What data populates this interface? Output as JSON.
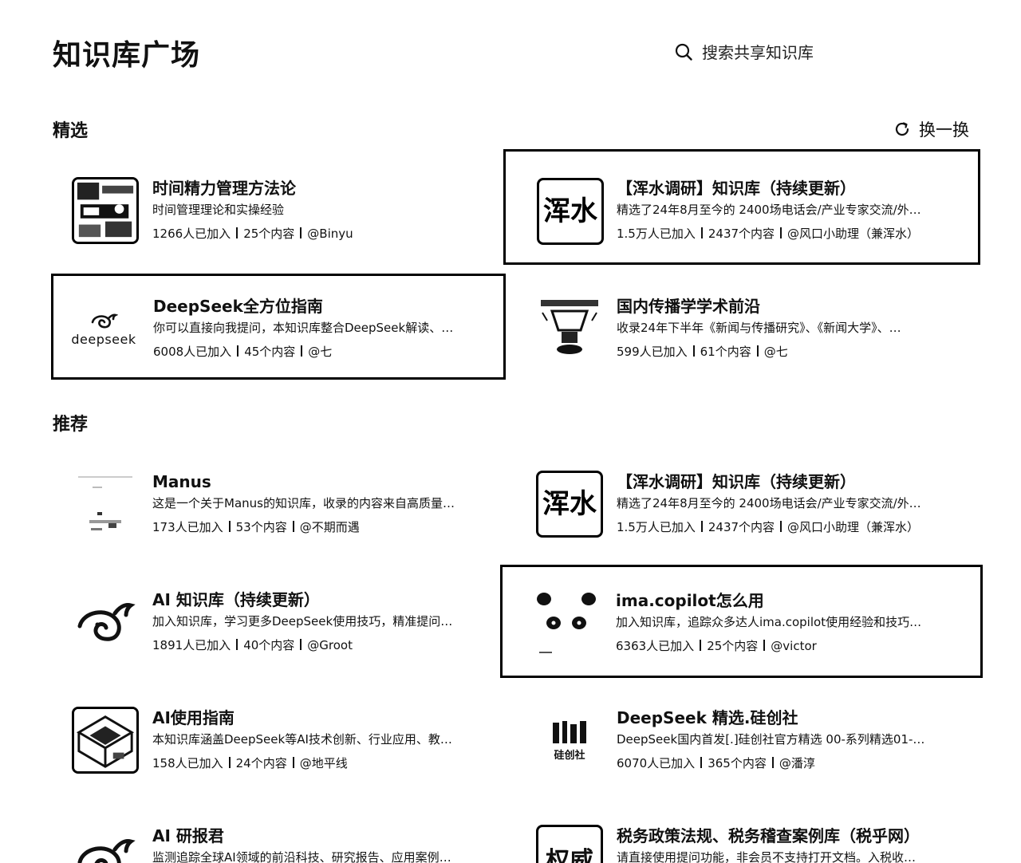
{
  "header": {
    "title": "知识库广场",
    "search_placeholder": "搜索共享知识库"
  },
  "featured": {
    "title": "精选",
    "refresh_label": "换一换",
    "cards": [
      {
        "name": "时间精力管理方法论",
        "desc": "时间管理理论和实操经验",
        "joined": "1266人已加入",
        "count": "25个内容",
        "author": "@Binyu",
        "thumb_icon": "sketch-illustration-icon",
        "highlighted": false
      },
      {
        "name": "【浑水调研】知识库（持续更新）",
        "desc": "精选了24年8月至今的 2400场电话会/产业专家交流/外…",
        "joined": "1.5万人已加入",
        "count": "2437个内容",
        "author": "@风口小助理（兼浑水）",
        "thumb_icon": "hunshui-logo-icon",
        "thumb_text": "浑水",
        "highlighted": true
      },
      {
        "name": "DeepSeek全方位指南",
        "desc": "你可以直接向我提问，本知识库整合DeepSeek解读、…",
        "joined": "6008人已加入",
        "count": "45个内容",
        "author": "@七",
        "thumb_icon": "deepseek-logo-icon",
        "thumb_text": "deepseek",
        "highlighted": true
      },
      {
        "name": "国内传播学学术前沿",
        "desc": "收录24年下半年《新闻与传播研究》、《新闻大学》、…",
        "joined": "599人已加入",
        "count": "61个内容",
        "author": "@七",
        "thumb_icon": "sketch-figure-icon",
        "highlighted": false
      }
    ]
  },
  "recommended": {
    "title": "推荐",
    "cards": [
      {
        "name": "Manus",
        "desc": "这是一个关于Manus的知识库，收录的内容来自高质量…",
        "joined": "173人已加入",
        "count": "53个内容",
        "author": "@不期而遇",
        "thumb_icon": "document-preview-icon",
        "highlighted": false
      },
      {
        "name": "【浑水调研】知识库（持续更新）",
        "desc": "精选了24年8月至今的 2400场电话会/产业专家交流/外…",
        "joined": "1.5万人已加入",
        "count": "2437个内容",
        "author": "@风口小助理（兼浑水）",
        "thumb_icon": "hunshui-logo-icon",
        "thumb_text": "浑水",
        "highlighted": false
      },
      {
        "name": "AI 知识库（持续更新）",
        "desc": "加入知识库，学习更多DeepSeek使用技巧，精准提问…",
        "joined": "1891人已加入",
        "count": "40个内容",
        "author": "@Groot",
        "thumb_icon": "whale-icon",
        "highlighted": false
      },
      {
        "name": "ima.copilot怎么用",
        "desc": "加入知识库，追踪众多达人ima.copilot使用经验和技巧…",
        "joined": "6363人已加入",
        "count": "25个内容",
        "author": "@victor",
        "thumb_icon": "panda-face-icon",
        "highlighted": true
      },
      {
        "name": "AI使用指南",
        "desc": "本知识库涵盖DeepSeek等AI技术创新、行业应用、教…",
        "joined": "158人已加入",
        "count": "24个内容",
        "author": "@地平线",
        "thumb_icon": "isometric-illustration-icon",
        "highlighted": false
      },
      {
        "name": "DeepSeek 精选.硅创社",
        "desc": "DeepSeek国内首发[.]硅创社官方精选 00-系列精选01-…",
        "joined": "6070人已加入",
        "count": "365个内容",
        "author": "@潘淳",
        "thumb_icon": "guichuangshe-logo-icon",
        "thumb_text": "硅创社",
        "highlighted": false
      },
      {
        "name": "AI 研报君",
        "desc": "监测追踪全球AI领域的前沿科技、研究报告、应用案例…",
        "joined": "",
        "count": "",
        "author": "",
        "thumb_icon": "whale-icon",
        "highlighted": false
      },
      {
        "name": "税务政策法规、税务稽查案例库（税乎网）",
        "desc": "请直接使用提问功能，非会员不支持打开文档。入税收…",
        "joined": "",
        "count": "",
        "author": "",
        "thumb_icon": "shuihu-logo-icon",
        "thumb_text": "权威",
        "highlighted": false
      }
    ]
  }
}
